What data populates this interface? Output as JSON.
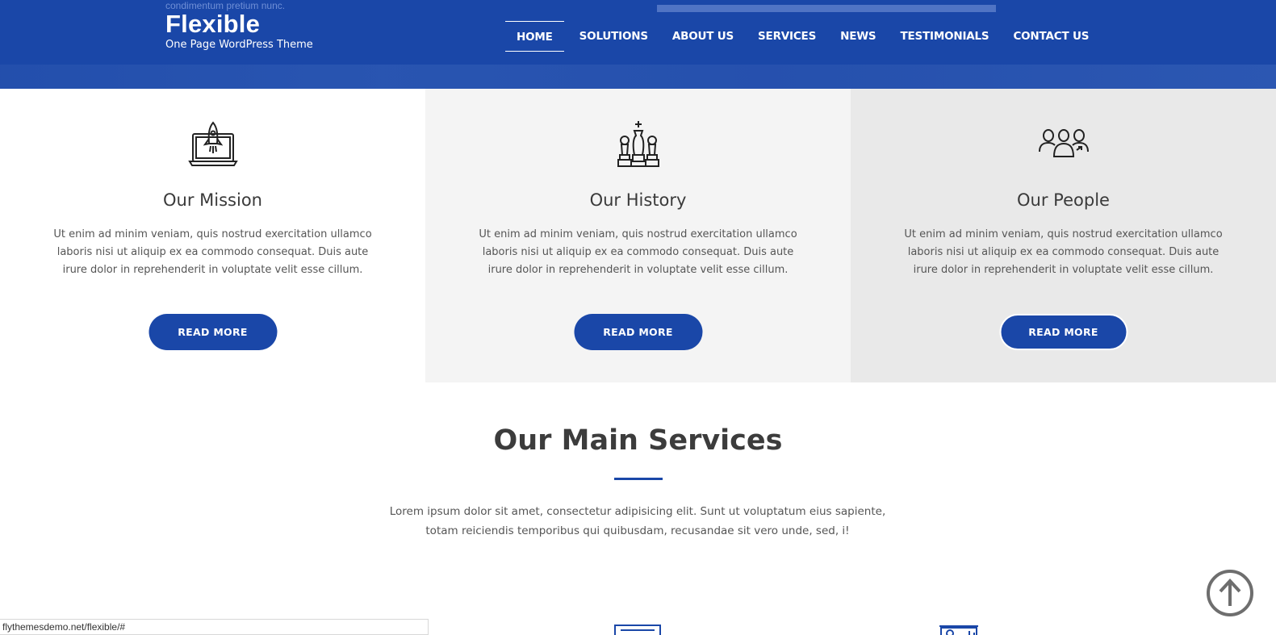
{
  "header": {
    "ghost_text": "condimentum pretium nunc.",
    "brand_title": "Flexible",
    "brand_subtitle": "One Page WordPress Theme",
    "nav": [
      "HOME",
      "SOLUTIONS",
      "ABOUT US",
      "SERVICES",
      "NEWS",
      "TESTIMONIALS",
      "CONTACT US"
    ],
    "active_nav": "HOME",
    "color": "#1a47a8"
  },
  "features": [
    {
      "icon": "rocket-laptop-icon",
      "title": "Our Mission",
      "text": "Ut enim ad minim veniam, quis nostrud exercitation ullamco laboris nisi ut aliquip ex ea commodo consequat. Duis aute irure dolor in reprehenderit in voluptate velit esse cillum.",
      "button": "READ MORE"
    },
    {
      "icon": "chess-pieces-icon",
      "title": "Our History",
      "text": "Ut enim ad minim veniam, quis nostrud exercitation ullamco laboris nisi ut aliquip ex ea commodo consequat. Duis aute irure dolor in reprehenderit in voluptate velit esse cillum.",
      "button": "READ MORE"
    },
    {
      "icon": "people-group-icon",
      "title": "Our People",
      "text": "Ut enim ad minim veniam, quis nostrud exercitation ullamco laboris nisi ut aliquip ex ea commodo consequat. Duis aute irure dolor in reprehenderit in voluptate velit esse cillum.",
      "button": "READ MORE"
    }
  ],
  "services": {
    "title": "Our Main Services",
    "text": "Lorem ipsum dolor sit amet, consectetur adipisicing elit. Sunt ut voluptatum eius sapiente, totam reiciendis temporibus qui quibusdam, recusandae sit vero unde, sed, i!"
  },
  "status_url": "flythemesdemo.net/flexible/#",
  "scroll_top_icon": "arrow-up-circle-icon"
}
